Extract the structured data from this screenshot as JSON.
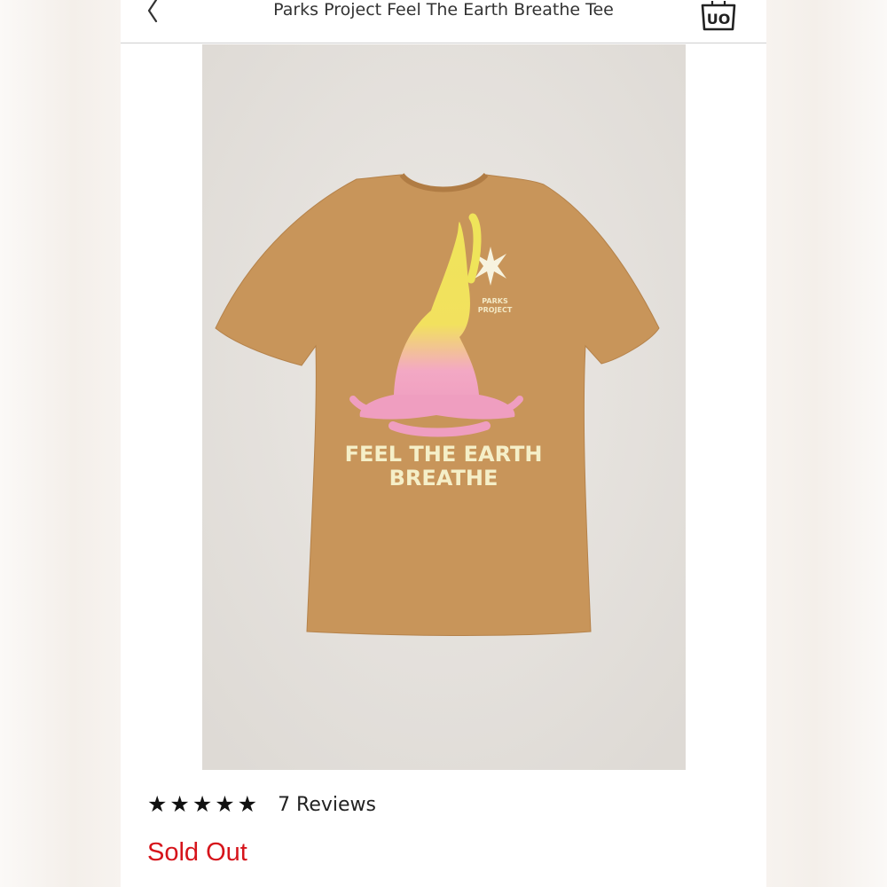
{
  "header": {
    "title": "Parks Project Feel The Earth Breathe Tee",
    "back_icon": "chevron-left-icon",
    "bag_icon": "shopping-bag-icon",
    "bag_label": "UO"
  },
  "product": {
    "shirt_color": "#c8955a",
    "graphic": {
      "brand_line1": "PARKS",
      "brand_line2": "PROJECT",
      "slogan_line1": "FEEL THE EARTH",
      "slogan_line2": "BREATHE"
    }
  },
  "rating": {
    "stars": 5,
    "star_glyphs": "★★★★★",
    "reviews_label": "7 Reviews"
  },
  "status": {
    "label": "Sold Out",
    "color": "#d6141b"
  }
}
